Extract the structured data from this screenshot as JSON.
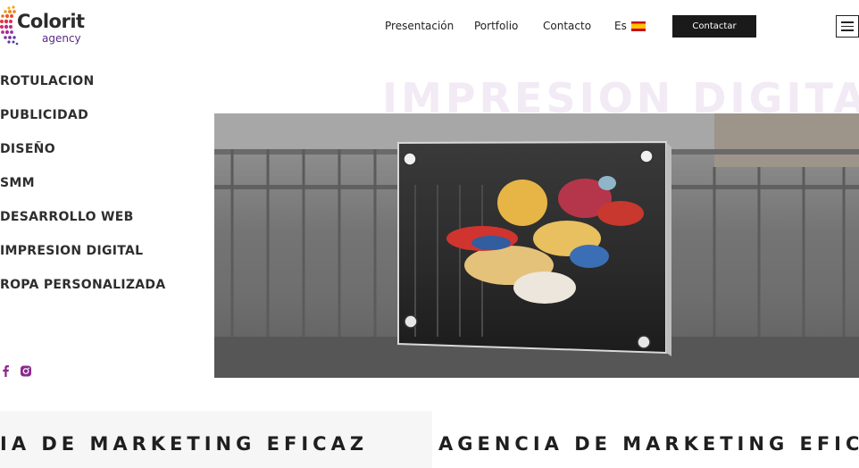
{
  "brand": {
    "name": "Colorit",
    "tagline": "agency"
  },
  "nav": {
    "items": [
      "Presentación",
      "Portfolio",
      "Contacto"
    ],
    "language": "Es",
    "cta_label": "Contactar"
  },
  "services": [
    "ROTULACION",
    "PUBLICIDAD",
    "DISEÑO",
    "SMM",
    "DESARROLLO WEB",
    "IMPRESION DIGITAL",
    "ROPA PERSONALIZADA"
  ],
  "hero": {
    "background_title": "IMPRESION DIGITAL"
  },
  "marquee": {
    "text_left": "IA DE MARKETING EFICAZ",
    "text_right": "AGENCIA DE MARKETING EFICAZ"
  },
  "colors": {
    "accent": "#8a2a8e",
    "dark": "#1a1a1a",
    "watermark": "#f2eaf4"
  },
  "icons": {
    "menu": "hamburger-icon",
    "facebook": "facebook-icon",
    "instagram": "instagram-icon",
    "flag": "spain-flag-icon"
  }
}
